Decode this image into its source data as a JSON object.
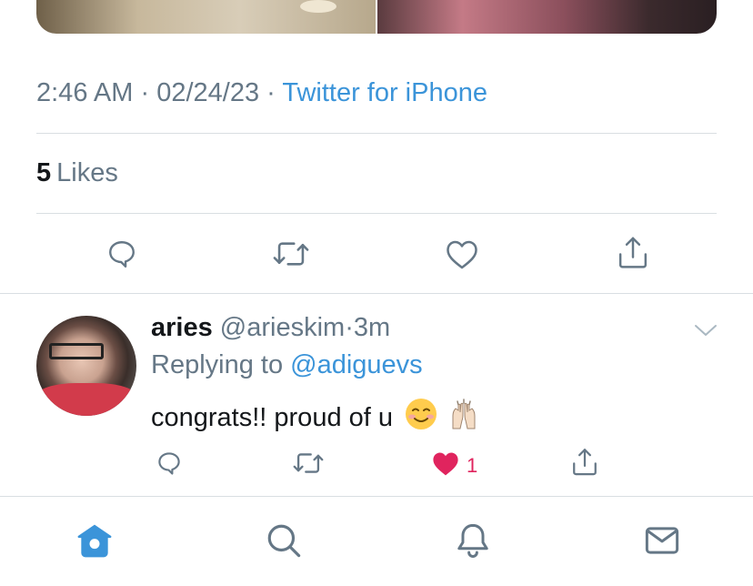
{
  "tweet": {
    "time": "2:46 AM",
    "separator": " · ",
    "date": "02/24/23",
    "source": "Twitter for iPhone",
    "likes_count": "5",
    "likes_label": "Likes"
  },
  "actions": {
    "icons": [
      "reply-icon",
      "retweet-icon",
      "like-icon",
      "share-icon"
    ]
  },
  "reply": {
    "name": "aries",
    "handle": "@arieskim",
    "dot": "·",
    "time": "3m",
    "replying_prefix": "Replying to",
    "replying_to": "@adiguevs",
    "text": "congrats!! proud of u",
    "emojis": [
      "smiling-face-emoji",
      "raising-hands-emoji"
    ],
    "like_count": "1",
    "liked": true
  },
  "tabbar": {
    "items": [
      "home-icon",
      "search-icon",
      "notifications-icon",
      "messages-icon"
    ],
    "active": "home-icon"
  },
  "colors": {
    "accent": "#3b94d9",
    "muted": "#657786",
    "like": "#e0245e",
    "divider": "#d9dee2"
  }
}
